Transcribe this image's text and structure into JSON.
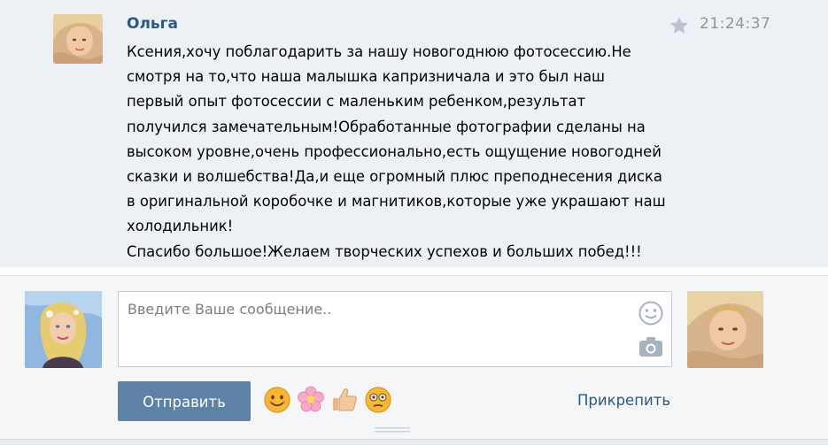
{
  "message": {
    "author": "Ольга",
    "time": "21:24:37",
    "lines": [
      "Ксения,хочу поблагодарить за нашу новогоднюю фотосессию.Не",
      "смотря на то,что наша малышка капризничала и это был наш",
      "первый опыт фотосессии с маленьким ребенком,результат",
      "получился замечательным!Обработанные фотографии сделаны на",
      "высоком уровне,очень профессионально,есть ощущение новогодней",
      "сказки и волшебства!Да,и еще огромный плюс преподнесения диска",
      "в оригинальной коробочке и магнитиков,которые уже украшают наш",
      "холодильник!",
      "Спасибо большое!Желаем творческих успехов и больших побед!!!"
    ]
  },
  "composer": {
    "placeholder": "Введите Ваше сообщение..",
    "send_label": "Отправить",
    "attach_label": "Прикрепить",
    "emoji": [
      "smiling-face",
      "flower",
      "thumbs-up",
      "flushed-face"
    ]
  },
  "colors": {
    "panel_bg": "#edf1f5",
    "link": "#2a5885",
    "button": "#5e81a8",
    "time": "#939393"
  },
  "icons": [
    "star-icon",
    "smile-icon",
    "camera-icon"
  ]
}
